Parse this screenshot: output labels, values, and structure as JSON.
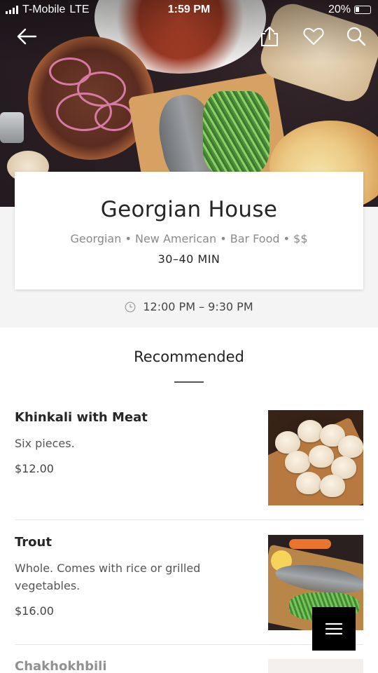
{
  "status_bar": {
    "carrier": "T-Mobile",
    "network": "LTE",
    "time": "1:59 PM",
    "battery": "20%"
  },
  "nav": {
    "icons": [
      "back-arrow-icon",
      "share-icon",
      "heart-icon",
      "search-icon"
    ]
  },
  "restaurant": {
    "name": "Georgian House",
    "categories": "Georgian • New American • Bar Food • $$",
    "eta": "30–40 MIN",
    "hours": "12:00 PM – 9:30 PM"
  },
  "section": {
    "title": "Recommended"
  },
  "items": [
    {
      "title": "Khinkali with Meat",
      "description": "Six pieces.",
      "price": "$12.00"
    },
    {
      "title": "Trout",
      "description": "Whole. Comes with rice or grilled vegetables.",
      "price": "$16.00"
    },
    {
      "title": "Chakhokhbili"
    }
  ],
  "colors": {
    "card_bg": "#ffffff",
    "band_bg": "#f4f4f4",
    "fab_bg": "#000000",
    "text_primary": "#262626",
    "text_muted": "#8a8a8a"
  }
}
